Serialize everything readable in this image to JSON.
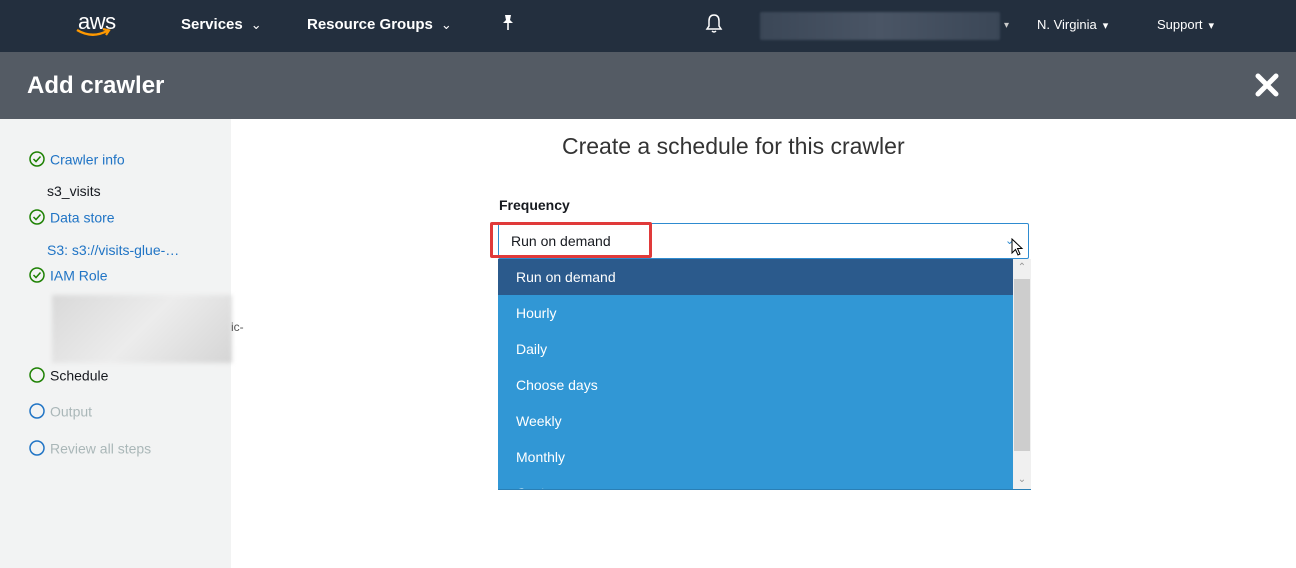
{
  "nav": {
    "logo_text": "aws",
    "services": "Services",
    "resource_groups": "Resource Groups",
    "region": "N. Virginia",
    "support": "Support"
  },
  "titlebar": {
    "title": "Add crawler"
  },
  "sidebar": {
    "steps": [
      {
        "label": "Crawler info",
        "state": "done",
        "detail": "s3_visits"
      },
      {
        "label": "Data store",
        "state": "done",
        "detail": "S3: s3://visits-glue-…"
      },
      {
        "label": "IAM Role",
        "state": "done",
        "detail_tail": "ic-"
      },
      {
        "label": "Schedule",
        "state": "current"
      },
      {
        "label": "Output",
        "state": "pending"
      },
      {
        "label": "Review all steps",
        "state": "pending"
      }
    ]
  },
  "main": {
    "title": "Create a schedule for this crawler",
    "frequency_label": "Frequency",
    "frequency_value": "Run on demand",
    "options": [
      "Run on demand",
      "Hourly",
      "Daily",
      "Choose days",
      "Weekly",
      "Monthly",
      "Custom"
    ]
  },
  "colors": {
    "nav_bg": "#232f3e",
    "titlebar_bg": "#545b64",
    "done_green": "#1d8102",
    "link_blue": "#2074c5",
    "dropdown_bg": "#3197d5",
    "selected_bg": "#2b5a8c",
    "highlight_red": "#e03a3a"
  }
}
